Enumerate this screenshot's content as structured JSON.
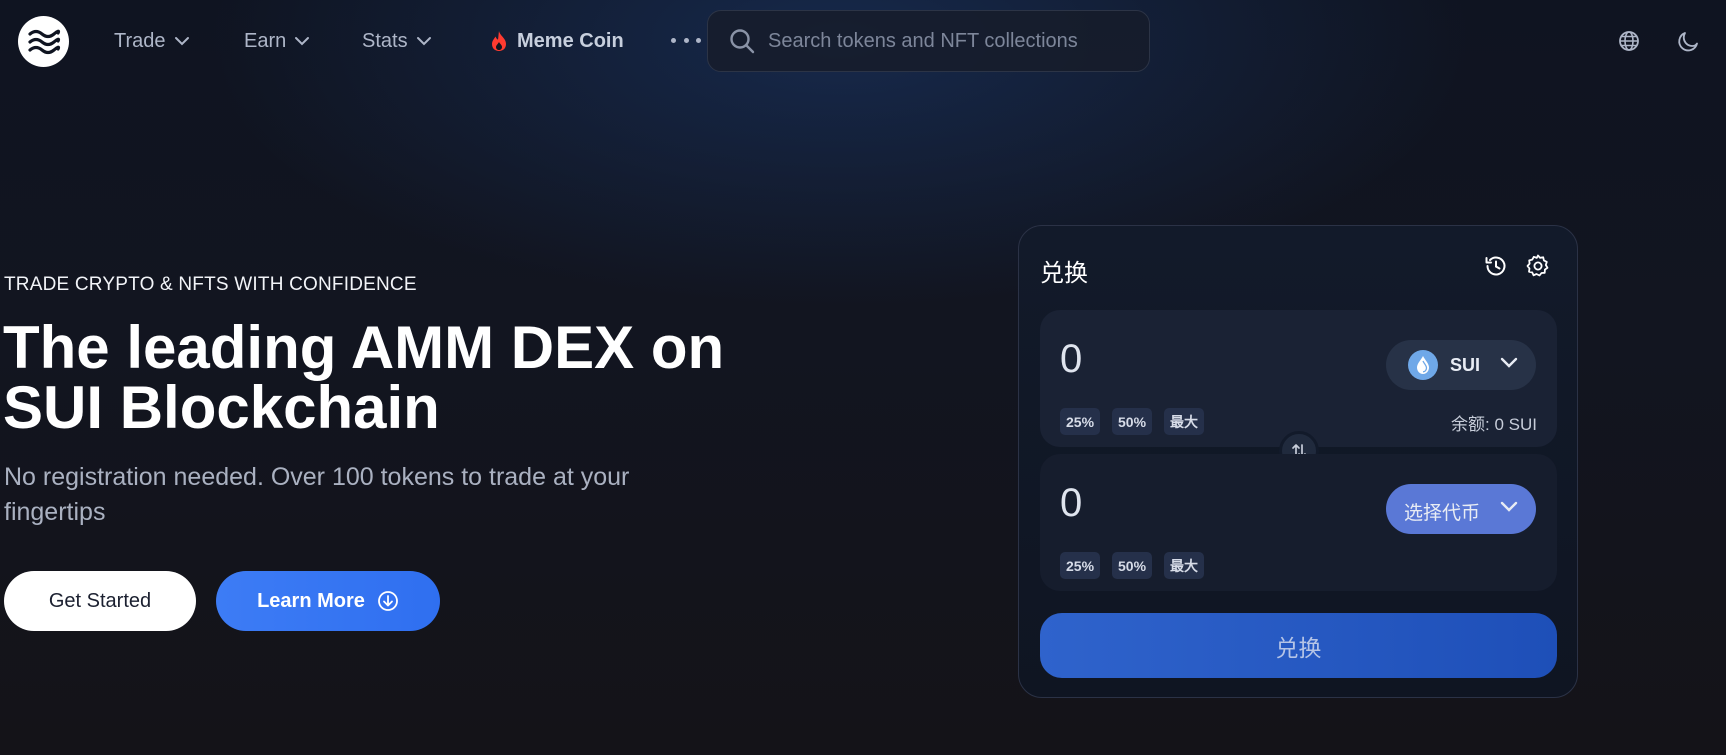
{
  "header": {
    "nav": [
      {
        "label": "Trade",
        "icon": "chevron-down-icon"
      },
      {
        "label": "Earn",
        "icon": "chevron-down-icon"
      },
      {
        "label": "Stats",
        "icon": "chevron-down-icon"
      }
    ],
    "meme": {
      "label": "Meme Coin",
      "icon": "fire-icon",
      "color": "#ff3b30"
    },
    "more_icon": "more-dots-icon",
    "search": {
      "placeholder": "Search tokens and NFT collections",
      "value": "",
      "icon": "search-icon"
    },
    "icons": [
      "globe-icon",
      "moon-icon"
    ]
  },
  "hero": {
    "eyebrow": "TRADE CRYPTO & NFTS WITH CONFIDENCE",
    "title_line1": "The leading AMM DEX on",
    "title_line2": "SUI Blockchain",
    "subtitle_line1": "No registration needed. Over 100 tokens to trade at your",
    "subtitle_line2": "fingertips",
    "get_started": "Get Started",
    "learn_more": "Learn More",
    "learn_more_icon": "arrow-down-circle-icon"
  },
  "swap": {
    "title": "兑换",
    "icons": [
      "history-icon",
      "settings-gear-icon"
    ],
    "from": {
      "amount": "0",
      "pct": [
        "25%",
        "50%",
        "最大"
      ],
      "token": "SUI",
      "token_icon": "sui-droplet-icon",
      "balance": "余额: 0 SUI"
    },
    "flip_icon": "swap-arrows-icon",
    "to": {
      "amount": "0",
      "pct": [
        "25%",
        "50%",
        "最大"
      ],
      "select_label": "选择代币"
    },
    "submit": "兑换"
  },
  "colors": {
    "accent_blue": "#3d7cf5",
    "swap_button": "#2f63cc",
    "token_select": "#5a78d6",
    "meme_fire": "#ff3b30"
  }
}
